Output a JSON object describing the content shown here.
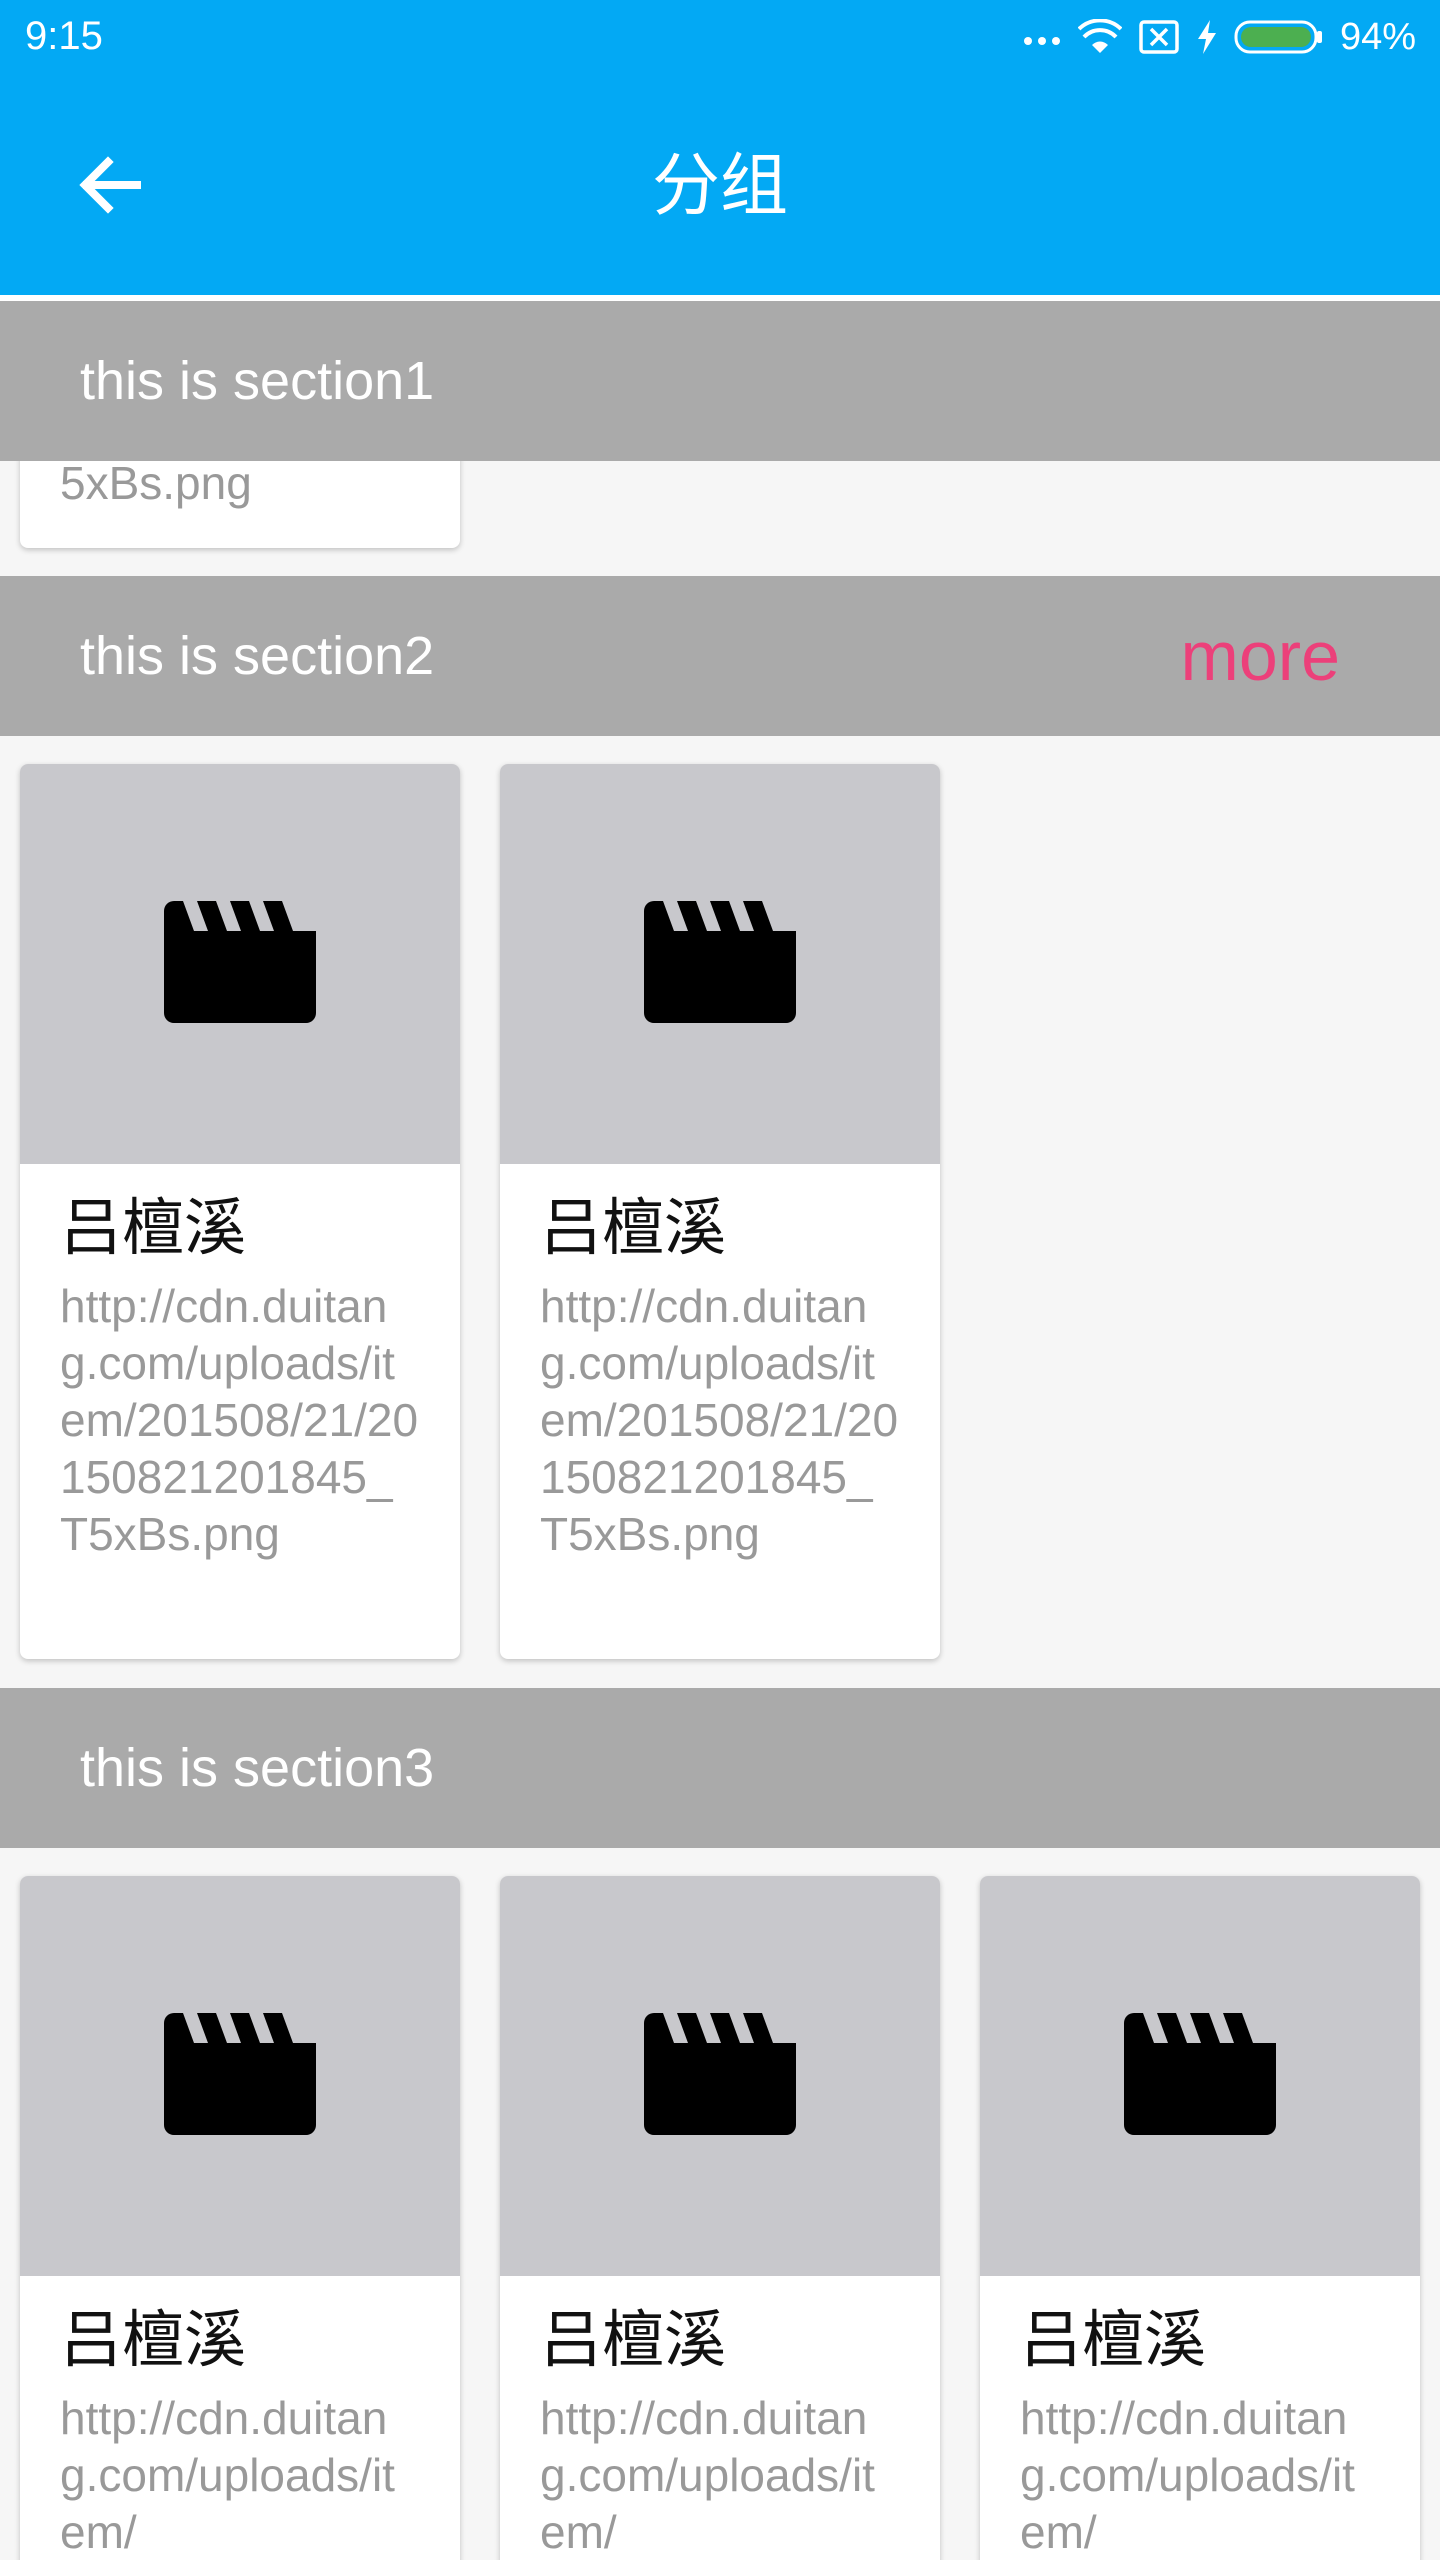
{
  "status_bar": {
    "time": "9:15",
    "battery_percent": "94%",
    "icons": [
      "more-dots-icon",
      "wifi-icon",
      "sim-off-icon",
      "charging-icon",
      "battery-icon"
    ]
  },
  "app_bar": {
    "title": "分组",
    "back_icon": "arrow-left-icon",
    "background": "#03a9f4"
  },
  "colors": {
    "section_header_bg": "#aaaaaa",
    "more_accent": "#ec407a",
    "thumb_bg": "#c8c8cc"
  },
  "sections": [
    {
      "title": "this is section1",
      "partial_card_text": "5xBs.png"
    },
    {
      "title": "this is section2",
      "more_label": "more",
      "cards": [
        {
          "title": "吕檀溪",
          "url": "http://cdn.duitang.com/uploads/item/201508/21/20150821201845_T5xBs.png",
          "icon": "video-clapperboard-icon"
        },
        {
          "title": "吕檀溪",
          "url": "http://cdn.duitang.com/uploads/item/201508/21/20150821201845_T5xBs.png",
          "icon": "video-clapperboard-icon"
        }
      ]
    },
    {
      "title": "this is section3",
      "cards": [
        {
          "title": "吕檀溪",
          "url": "http://cdn.duitang.com/uploads/item/",
          "icon": "video-clapperboard-icon"
        },
        {
          "title": "吕檀溪",
          "url": "http://cdn.duitang.com/uploads/item/",
          "icon": "video-clapperboard-icon"
        },
        {
          "title": "吕檀溪",
          "url": "http://cdn.duitang.com/uploads/item/",
          "icon": "video-clapperboard-icon"
        }
      ]
    }
  ]
}
